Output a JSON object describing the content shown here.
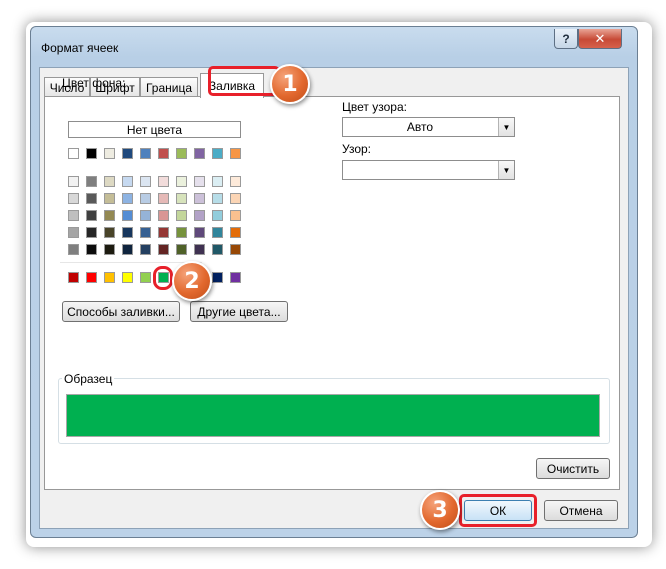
{
  "dialog": {
    "title": "Формат ячеек",
    "help_label": "?",
    "close_label": "✕"
  },
  "tabs": [
    {
      "label": "Число",
      "active": false
    },
    {
      "label": "Шрифт",
      "active": false
    },
    {
      "label": "Граница",
      "active": false
    },
    {
      "label": "Заливка",
      "active": true
    }
  ],
  "fill": {
    "background_label": "Цвет фона:",
    "no_color_label": "Нет цвета",
    "fill_effects_label": "Способы заливки...",
    "more_colors_label": "Другие цвета...",
    "selected_color": "#00b050"
  },
  "palette": {
    "theme_top": [
      "#ffffff",
      "#000000",
      "#eeece1",
      "#1f497d",
      "#4f81bd",
      "#c0504d",
      "#9bbb59",
      "#8064a2",
      "#4bacc6",
      "#f79646"
    ],
    "theme_rows": [
      [
        "#f2f2f2",
        "#7f7f7f",
        "#ddd9c3",
        "#c6d9f0",
        "#dbe5f1",
        "#f2dcdb",
        "#ebf1dd",
        "#e5e0ec",
        "#dbeef3",
        "#fdeada"
      ],
      [
        "#d8d8d8",
        "#595959",
        "#c4bd97",
        "#8db3e2",
        "#b8cce4",
        "#e5b9b7",
        "#d7e3bc",
        "#ccc1d9",
        "#b7dde8",
        "#fbd5b5"
      ],
      [
        "#bfbfbf",
        "#3f3f3f",
        "#938953",
        "#548dd4",
        "#95b3d7",
        "#d99694",
        "#c3d69b",
        "#b2a2c7",
        "#92cddc",
        "#fac08f"
      ],
      [
        "#a5a5a5",
        "#262626",
        "#494429",
        "#17365d",
        "#366092",
        "#953734",
        "#76923c",
        "#5f497a",
        "#31859b",
        "#e36c09"
      ],
      [
        "#7f7f7f",
        "#0c0c0c",
        "#1d1b10",
        "#0f243e",
        "#244061",
        "#632423",
        "#4f6128",
        "#3f3151",
        "#205867",
        "#974806"
      ]
    ],
    "standard": [
      "#c00000",
      "#ff0000",
      "#ffc000",
      "#ffff00",
      "#92d050",
      "#00b050",
      "#00b0f0",
      "#0070c0",
      "#002060",
      "#7030a0"
    ]
  },
  "pattern": {
    "color_label": "Цвет узора:",
    "color_value": "Авто",
    "pattern_label": "Узор:",
    "pattern_value": ""
  },
  "sample": {
    "label": "Образец",
    "clear_label": "Очистить"
  },
  "footer": {
    "ok_label": "ОК",
    "cancel_label": "Отмена"
  },
  "callouts": [
    "1",
    "2",
    "3"
  ],
  "colors": {
    "callout": "#e2682e",
    "highlight": "#e8202a"
  }
}
